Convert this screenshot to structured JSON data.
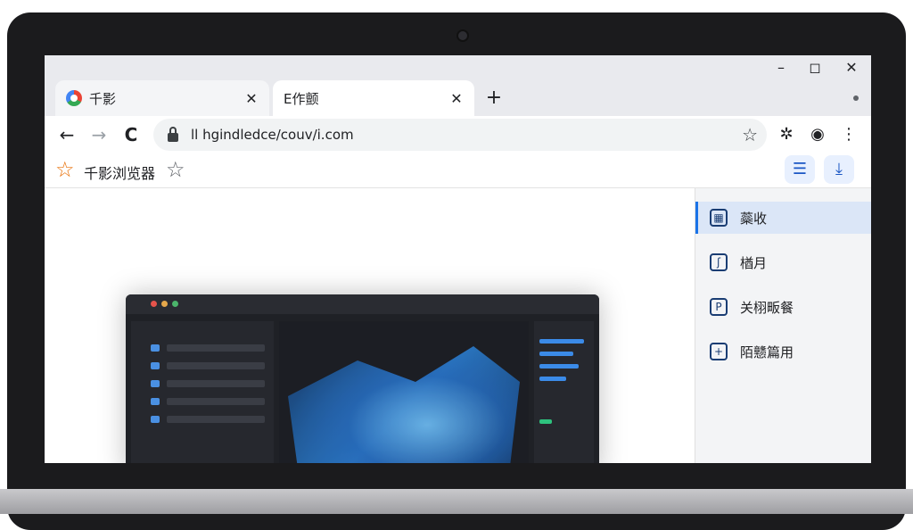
{
  "window": {
    "minimize_label": "–",
    "maximize_label": "◻",
    "close_label": "✕"
  },
  "tabs": [
    {
      "title": "千影",
      "close": "✕"
    },
    {
      "title": "E作颤",
      "close": "✕"
    }
  ],
  "new_tab_label": "+",
  "toolbar": {
    "back_label": "←",
    "forward_label": "→",
    "reload_label": "C",
    "url": "ll hgindledce/couv/i.com",
    "bookmark_star": "☆",
    "extension_icon": "✲",
    "profile_icon": "◉",
    "menu_icon": "⋮"
  },
  "bookmarks_bar": {
    "star": "☆",
    "label": "千影浏览器",
    "add_star": "☆",
    "button_1": "☰",
    "button_2": "⤓"
  },
  "side_panel": {
    "items": [
      {
        "label": "蘂收",
        "icon": "▦",
        "active": true
      },
      {
        "label": "楢月",
        "icon": "ʃ",
        "active": false
      },
      {
        "label": "关栩畈餐",
        "icon": "P",
        "active": false
      },
      {
        "label": "陌戆篇用",
        "icon": "+",
        "active": false
      }
    ]
  },
  "colors": {
    "accent": "#1a73e8",
    "bookmark_star": "#e8710a",
    "side_active_bg": "#dbe6f7"
  }
}
